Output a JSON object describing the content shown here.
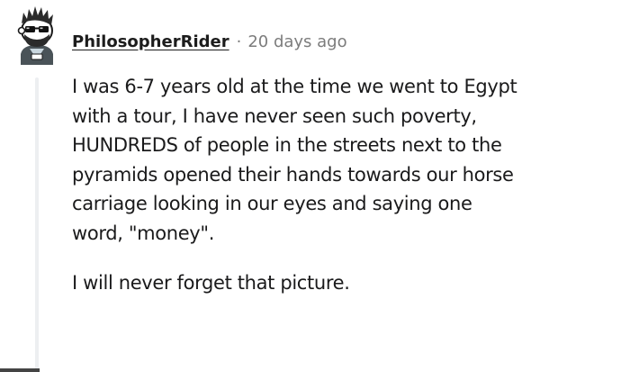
{
  "comment": {
    "author": "PhilosopherRider",
    "separator": "·",
    "timestamp": "20 days ago",
    "avatar_icon": "snoo-avatar-icon",
    "paragraphs": [
      [
        "I was 6-7 years old at the time we went to Egypt",
        "with a tour, I have never seen such poverty,",
        "HUNDREDS of people in the streets next to the",
        "pyramids opened their hands towards our horse",
        "carriage looking in our eyes and saying one",
        "word, \"money\"."
      ],
      [
        "I will never forget that picture."
      ]
    ]
  }
}
